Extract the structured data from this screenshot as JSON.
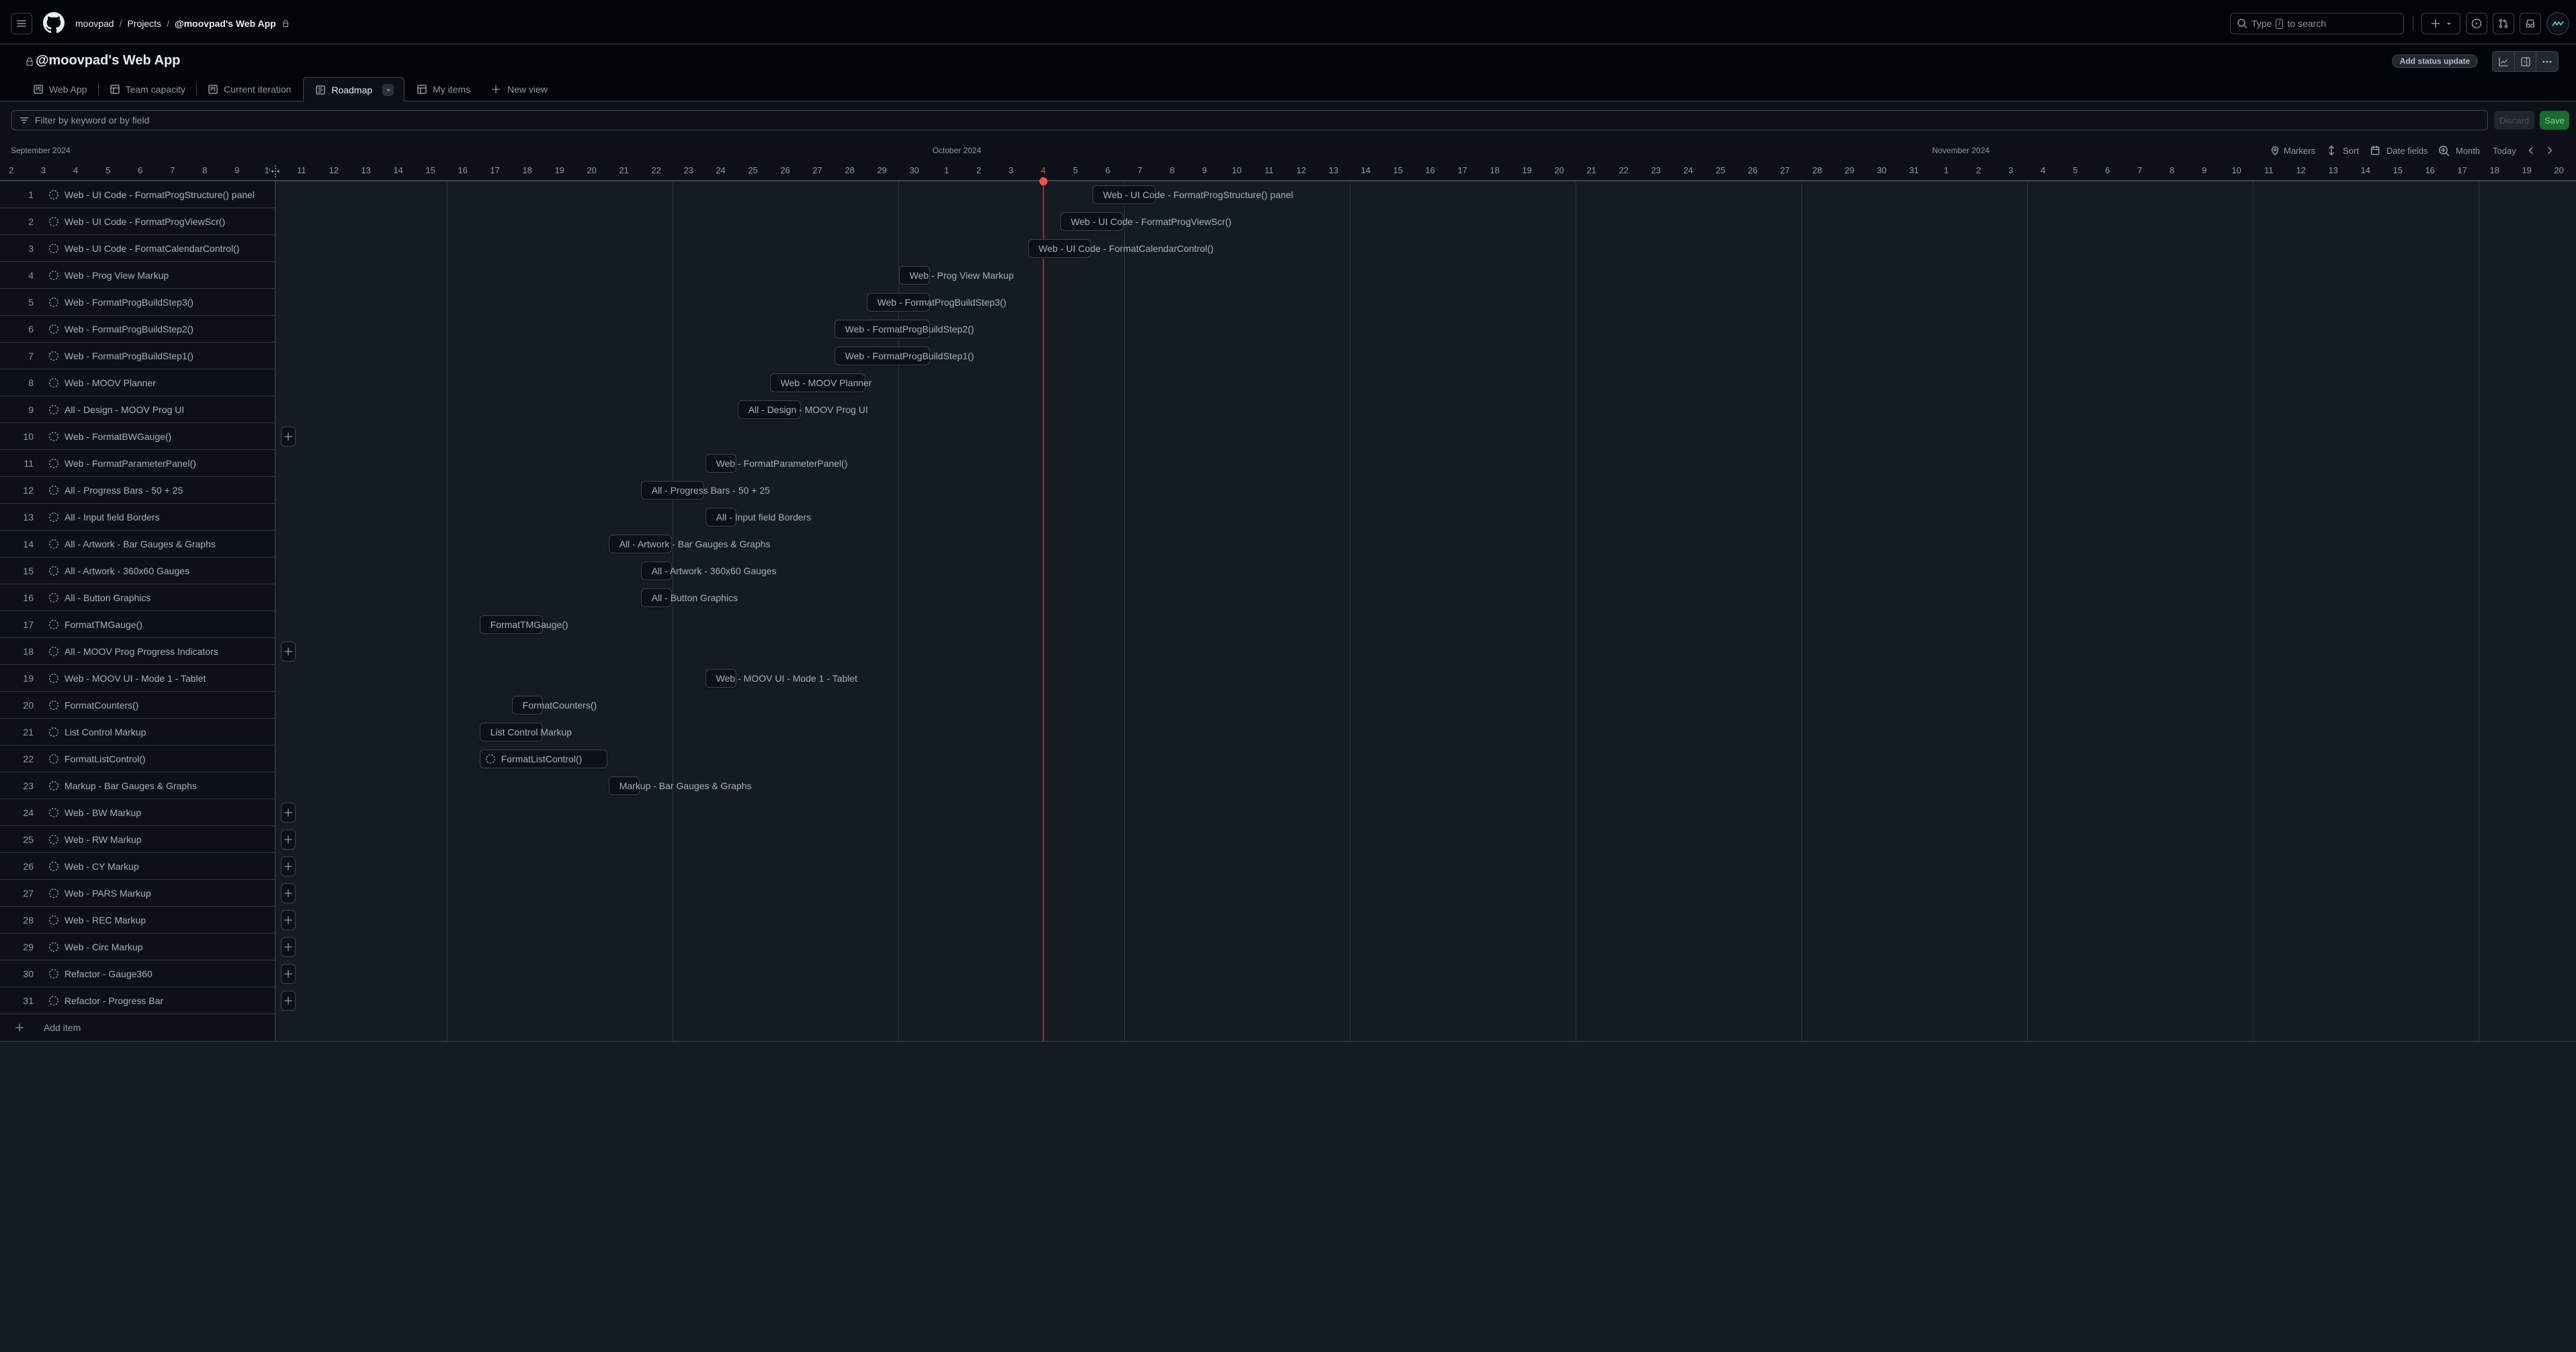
{
  "topbar": {
    "breadcrumb": [
      "moovpad",
      "Projects",
      "@moovpad's Web App"
    ],
    "search": {
      "prefix": "Type",
      "key": "/",
      "suffix": "to search"
    }
  },
  "project": {
    "title": "@moovpad's Web App",
    "visibility": "private",
    "status_update_button": "Add status update"
  },
  "tabs": [
    {
      "label": "Web App",
      "icon": "project-board-icon"
    },
    {
      "label": "Team capacity",
      "icon": "table-icon"
    },
    {
      "label": "Current iteration",
      "icon": "project-board-icon"
    },
    {
      "label": "Roadmap",
      "icon": "roadmap-icon",
      "active": true
    },
    {
      "label": "My items",
      "icon": "table-icon"
    }
  ],
  "new_view": {
    "label": "New view"
  },
  "filter": {
    "placeholder": "Filter by keyword or by field",
    "value": "",
    "discard_label": "Discard",
    "save_label": "Save"
  },
  "toolbar": {
    "markers": "Markers",
    "sort": "Sort",
    "date_fields": "Date fields",
    "zoom_level": "Month",
    "today": "Today"
  },
  "timeline": {
    "start_date": "2024-09-02",
    "today": "2024-10-04",
    "months": [
      {
        "label": "September 2024",
        "first_day": "2024-09-01"
      },
      {
        "label": "October 2024",
        "first_day": "2024-10-01"
      },
      {
        "label": "November 2024",
        "first_day": "2024-11-01"
      }
    ],
    "days": [
      2,
      3,
      4,
      5,
      6,
      7,
      8,
      9,
      10,
      11,
      12,
      13,
      14,
      15,
      16,
      17,
      18,
      19,
      20,
      21,
      22,
      23,
      24,
      25,
      26,
      27,
      28,
      29,
      30,
      1,
      2,
      3,
      4,
      5,
      6,
      7,
      8,
      9,
      10,
      11,
      12,
      13,
      14,
      15,
      16,
      17,
      18,
      19,
      20,
      21,
      22,
      23,
      24,
      25,
      26,
      27,
      28,
      29,
      30,
      31,
      1,
      2,
      3,
      4,
      5,
      6,
      7,
      8,
      9,
      10,
      11,
      12,
      13,
      14,
      15,
      16,
      17,
      18,
      19,
      20
    ]
  },
  "items": [
    {
      "n": 1,
      "title": "Web - UI Code - FormatProgStructure() panel",
      "start": "2024-10-06",
      "end": "2024-10-07"
    },
    {
      "n": 2,
      "title": "Web - UI Code - FormatProgViewScr()",
      "start": "2024-10-05",
      "end": "2024-10-06"
    },
    {
      "n": 3,
      "title": "Web - UI Code - FormatCalendarControl()",
      "start": "2024-10-04",
      "end": "2024-10-05"
    },
    {
      "n": 4,
      "title": "Web - Prog View Markup",
      "start": "2024-09-30",
      "end": "2024-09-30"
    },
    {
      "n": 5,
      "title": "Web - FormatProgBuildStep3()",
      "start": "2024-09-29",
      "end": "2024-09-30"
    },
    {
      "n": 6,
      "title": "Web - FormatProgBuildStep2()",
      "start": "2024-09-28",
      "end": "2024-09-30"
    },
    {
      "n": 7,
      "title": "Web - FormatProgBuildStep1()",
      "start": "2024-09-28",
      "end": "2024-09-30"
    },
    {
      "n": 8,
      "title": "Web - MOOV Planner",
      "start": "2024-09-26",
      "end": "2024-09-28"
    },
    {
      "n": 9,
      "title": "All - Design - MOOV Prog UI",
      "start": "2024-09-25",
      "end": "2024-09-26"
    },
    {
      "n": 10,
      "title": "Web - FormatBWGauge()",
      "start": null,
      "end": null
    },
    {
      "n": 11,
      "title": "Web - FormatParameterPanel()",
      "start": "2024-09-24",
      "end": "2024-09-24"
    },
    {
      "n": 12,
      "title": "All - Progress Bars - 50 + 25",
      "start": "2024-09-22",
      "end": "2024-09-23"
    },
    {
      "n": 13,
      "title": "All - Input field Borders",
      "start": "2024-09-24",
      "end": "2024-09-24"
    },
    {
      "n": 14,
      "title": "All - Artwork - Bar Gauges & Graphs",
      "start": "2024-09-21",
      "end": "2024-09-22"
    },
    {
      "n": 15,
      "title": "All - Artwork - 360x60 Gauges",
      "start": "2024-09-22",
      "end": "2024-09-22"
    },
    {
      "n": 16,
      "title": "All - Button Graphics",
      "start": "2024-09-22",
      "end": "2024-09-22"
    },
    {
      "n": 17,
      "title": "FormatTMGauge()",
      "start": "2024-09-17",
      "end": "2024-09-18"
    },
    {
      "n": 18,
      "title": "All - MOOV Prog Progress Indicators",
      "start": null,
      "end": null
    },
    {
      "n": 19,
      "title": "Web - MOOV UI - Mode 1 - Tablet",
      "start": "2024-09-24",
      "end": "2024-09-24"
    },
    {
      "n": 20,
      "title": "FormatCounters()",
      "start": "2024-09-18",
      "end": "2024-09-18"
    },
    {
      "n": 21,
      "title": "List Control Markup",
      "start": "2024-09-17",
      "end": "2024-09-18"
    },
    {
      "n": 22,
      "title": "FormatListControl()",
      "start": "2024-09-17",
      "end": "2024-09-20"
    },
    {
      "n": 23,
      "title": "Markup - Bar Gauges & Graphs",
      "start": "2024-09-21",
      "end": "2024-09-21"
    },
    {
      "n": 24,
      "title": "Web - BW Markup",
      "start": null,
      "end": null
    },
    {
      "n": 25,
      "title": "Web - RW Markup",
      "start": null,
      "end": null
    },
    {
      "n": 26,
      "title": "Web - CY Markup",
      "start": null,
      "end": null
    },
    {
      "n": 27,
      "title": "Web - PARS Markup",
      "start": null,
      "end": null
    },
    {
      "n": 28,
      "title": "Web - REC Markup",
      "start": null,
      "end": null
    },
    {
      "n": 29,
      "title": "Web - Circ Markup",
      "start": null,
      "end": null
    },
    {
      "n": 30,
      "title": "Refactor - Gauge360",
      "start": null,
      "end": null
    },
    {
      "n": 31,
      "title": "Refactor - Progress Bar",
      "start": null,
      "end": null
    }
  ],
  "add_item_label": "Add item",
  "colors": {
    "today_marker": "#f85149",
    "save_button": "#196c2e",
    "avatar_accent": "#2bd4c0"
  }
}
